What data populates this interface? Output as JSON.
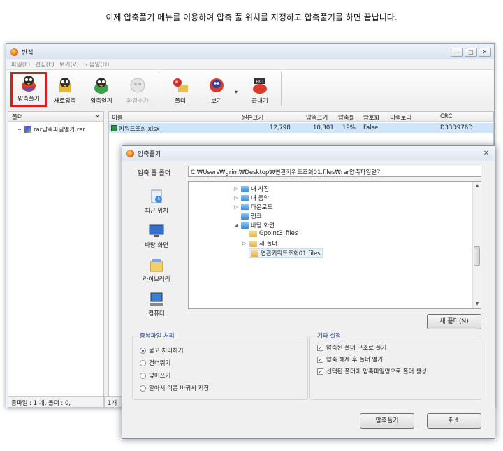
{
  "caption": "이제 압축풀기 메뉴를 이용하여  압축 풀 위치를 지정하고 압축풀기를 하면 끝납니다.",
  "window": {
    "title": "반집",
    "controls": [
      "—",
      "▢",
      "✕"
    ]
  },
  "menu": [
    "파일(F)",
    "편집(E)",
    "보기(V)",
    "도움말(H)"
  ],
  "toolbar": {
    "buttons": [
      {
        "label": "압축풀기",
        "icon": "extract-icon"
      },
      {
        "label": "새로압축",
        "icon": "new-archive-icon"
      },
      {
        "label": "압축열기",
        "icon": "open-archive-icon"
      },
      {
        "label": "파일추가",
        "icon": "add-file-icon"
      },
      {
        "label": "폴더",
        "icon": "folder-pin-icon"
      },
      {
        "label": "보기",
        "icon": "view-icon"
      },
      {
        "label": "끝내기",
        "icon": "exit-icon"
      }
    ]
  },
  "folder_pane": {
    "header": "폴더",
    "close": "×",
    "item": "rar압축파일열기.rar"
  },
  "file_list": {
    "columns": [
      "이름",
      "원본크기",
      "압축크기",
      "압축률",
      "암호화",
      "디렉토리",
      "CRC"
    ],
    "rows": [
      {
        "name": "키워드조회.xlsx",
        "original": "12,798",
        "compressed": "10,301",
        "ratio": "19%",
        "encrypted": "False",
        "dir": "",
        "crc": "D33D976D"
      }
    ]
  },
  "status": {
    "left": "총파일 : 1 개, 폴더 : 0,",
    "right": "1개"
  },
  "dialog": {
    "title": "압축풀기",
    "close": "✕",
    "dest_label": "압축 풀 폴더",
    "dest_value": "C:₩Users₩grim₩Desktop₩연관키워드조회01.files₩rar압축파일열기",
    "places": [
      "최근 위치",
      "바탕 화면",
      "라이브러리",
      "컴퓨터"
    ],
    "tree": [
      "내 사진",
      "내 음악",
      "다운로드",
      "링크",
      "바탕 화면",
      "Gpoint3_files",
      "새 폴더",
      "연관키워드조회01.files"
    ],
    "new_folder": "새 폴더(N)",
    "dup_group": {
      "title": "중복파일 처리",
      "options": [
        "묻고 처리하기",
        "건너뛰기",
        "덮어쓰기",
        "알아서 이름 바꿔서 저장"
      ],
      "selected_index": 0
    },
    "etc_group": {
      "title": "기타 설정",
      "options": [
        "압축된 폴더 구조로 풀기",
        "압축 해제 후 폴더 열기",
        "선택된 폴더에 압축파일명으로 폴더 생성"
      ],
      "checked": [
        true,
        true,
        true
      ]
    },
    "ok": "압축풀기",
    "cancel": "취소"
  },
  "colors": {
    "highlight_border": "#e11a1a",
    "selection": "#cde6fb",
    "group_title": "#1b3f8c"
  }
}
